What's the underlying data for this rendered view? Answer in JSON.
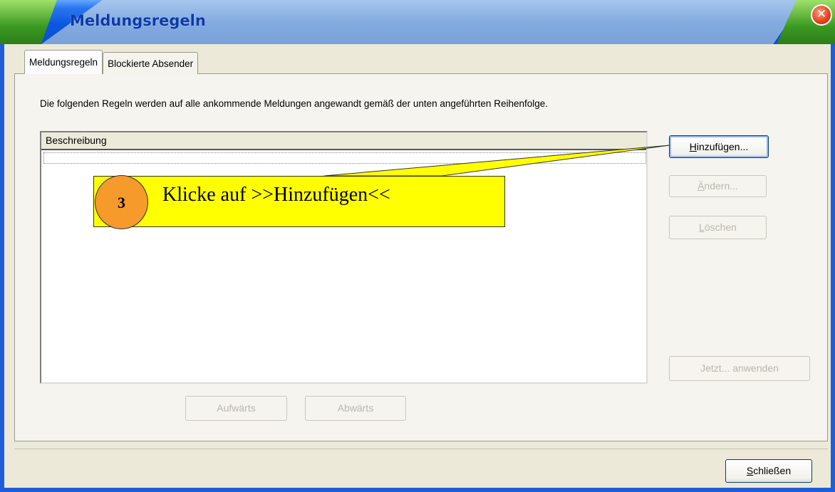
{
  "window": {
    "title": "Meldungsregeln",
    "close_glyph": "✕"
  },
  "tabs": [
    {
      "label": "Meldungsregeln",
      "active": true
    },
    {
      "label": "Blockierte Absender",
      "active": false
    }
  ],
  "description": "Die folgenden Regeln werden auf alle ankommende Meldungen angewandt gemäß der unten angeführten Reihenfolge.",
  "list": {
    "column_header": "Beschreibung",
    "rows": []
  },
  "buttons": {
    "add": {
      "label_u": "H",
      "label_rest": "inzufügen...",
      "enabled": true
    },
    "edit": {
      "label_u": "Ä",
      "label_rest": "ndern...",
      "enabled": false
    },
    "delete": {
      "label_u": "L",
      "label_rest": "öschen",
      "enabled": false
    },
    "apply_now": {
      "label": "Jetzt... anwenden",
      "enabled": false
    },
    "up": {
      "label": "Aufwärts",
      "enabled": false
    },
    "down": {
      "label": "Abwärts",
      "enabled": false
    },
    "close": {
      "label_u": "S",
      "label_rest": "chließen",
      "enabled": true
    }
  },
  "annotation": {
    "step_number": "3",
    "text": "Klicke auf >>Hinzufügen<<",
    "colors": {
      "box": "#ffff00",
      "circle": "#f79a2c"
    }
  },
  "colors": {
    "titlebar_blue": "#0b58e0",
    "dialog_bg": "#ece9d8",
    "titlebar_green": "#3b9a22"
  }
}
